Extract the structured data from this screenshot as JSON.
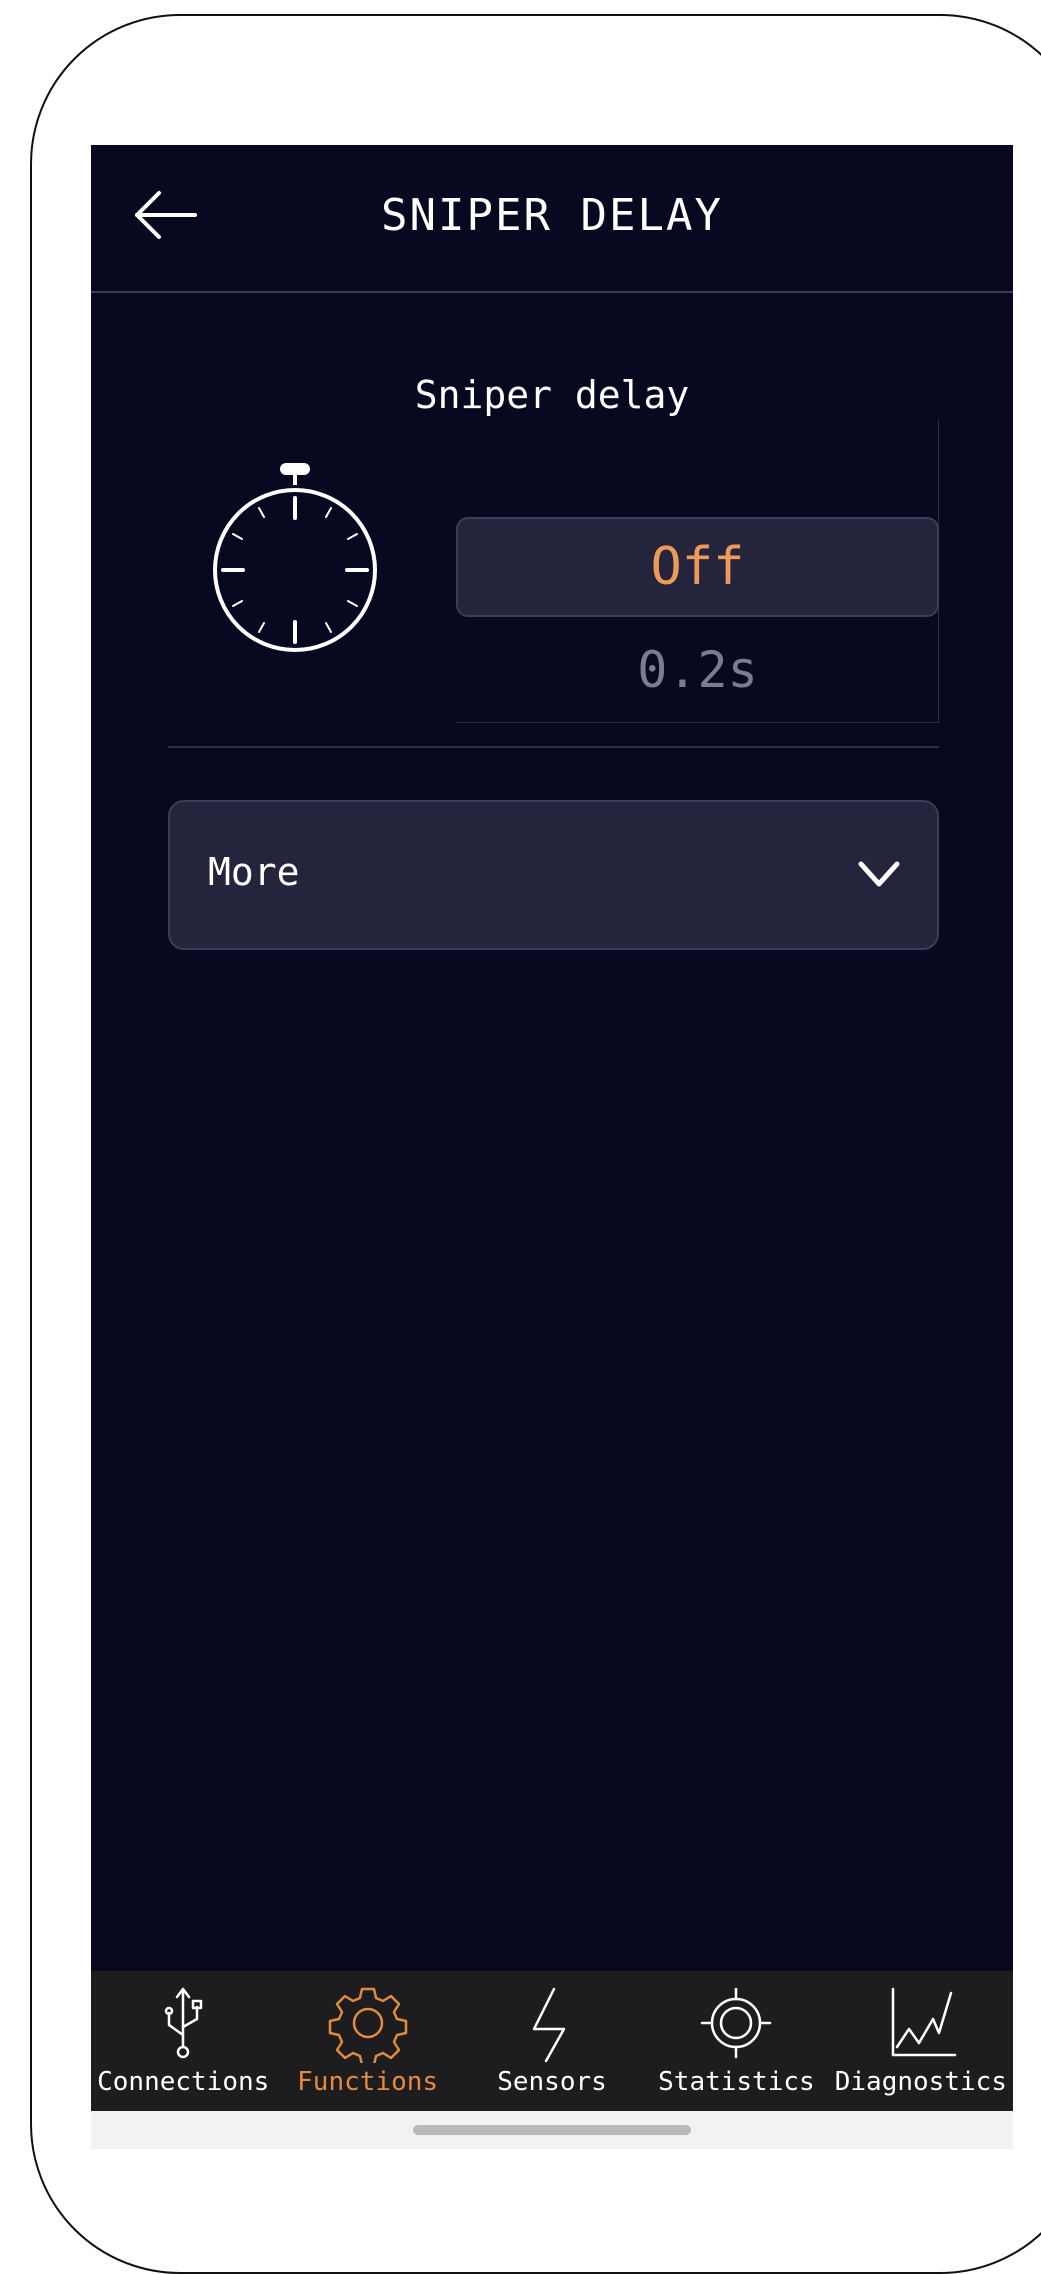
{
  "header": {
    "title": "SNIPER DELAY",
    "back_icon": "arrow-left-icon"
  },
  "setting": {
    "title": "Sniper delay",
    "icon": "stopwatch-icon",
    "picker": {
      "selected": "Off",
      "next_option": "0.2s"
    }
  },
  "more": {
    "label": "More",
    "icon": "chevron-down-icon"
  },
  "nav": {
    "items": [
      {
        "label": "Connections",
        "icon": "usb-icon",
        "active": false
      },
      {
        "label": "Functions",
        "icon": "gear-icon",
        "active": true
      },
      {
        "label": "Sensors",
        "icon": "lightning-icon",
        "active": false
      },
      {
        "label": "Statistics",
        "icon": "crosshair-icon",
        "active": false
      },
      {
        "label": "Diagnostics",
        "icon": "line-chart-icon",
        "active": false
      }
    ]
  },
  "colors": {
    "background": "#070920",
    "accent": "#e38a3e",
    "panel": "#24253c",
    "nav_background": "#1d1d1f"
  }
}
